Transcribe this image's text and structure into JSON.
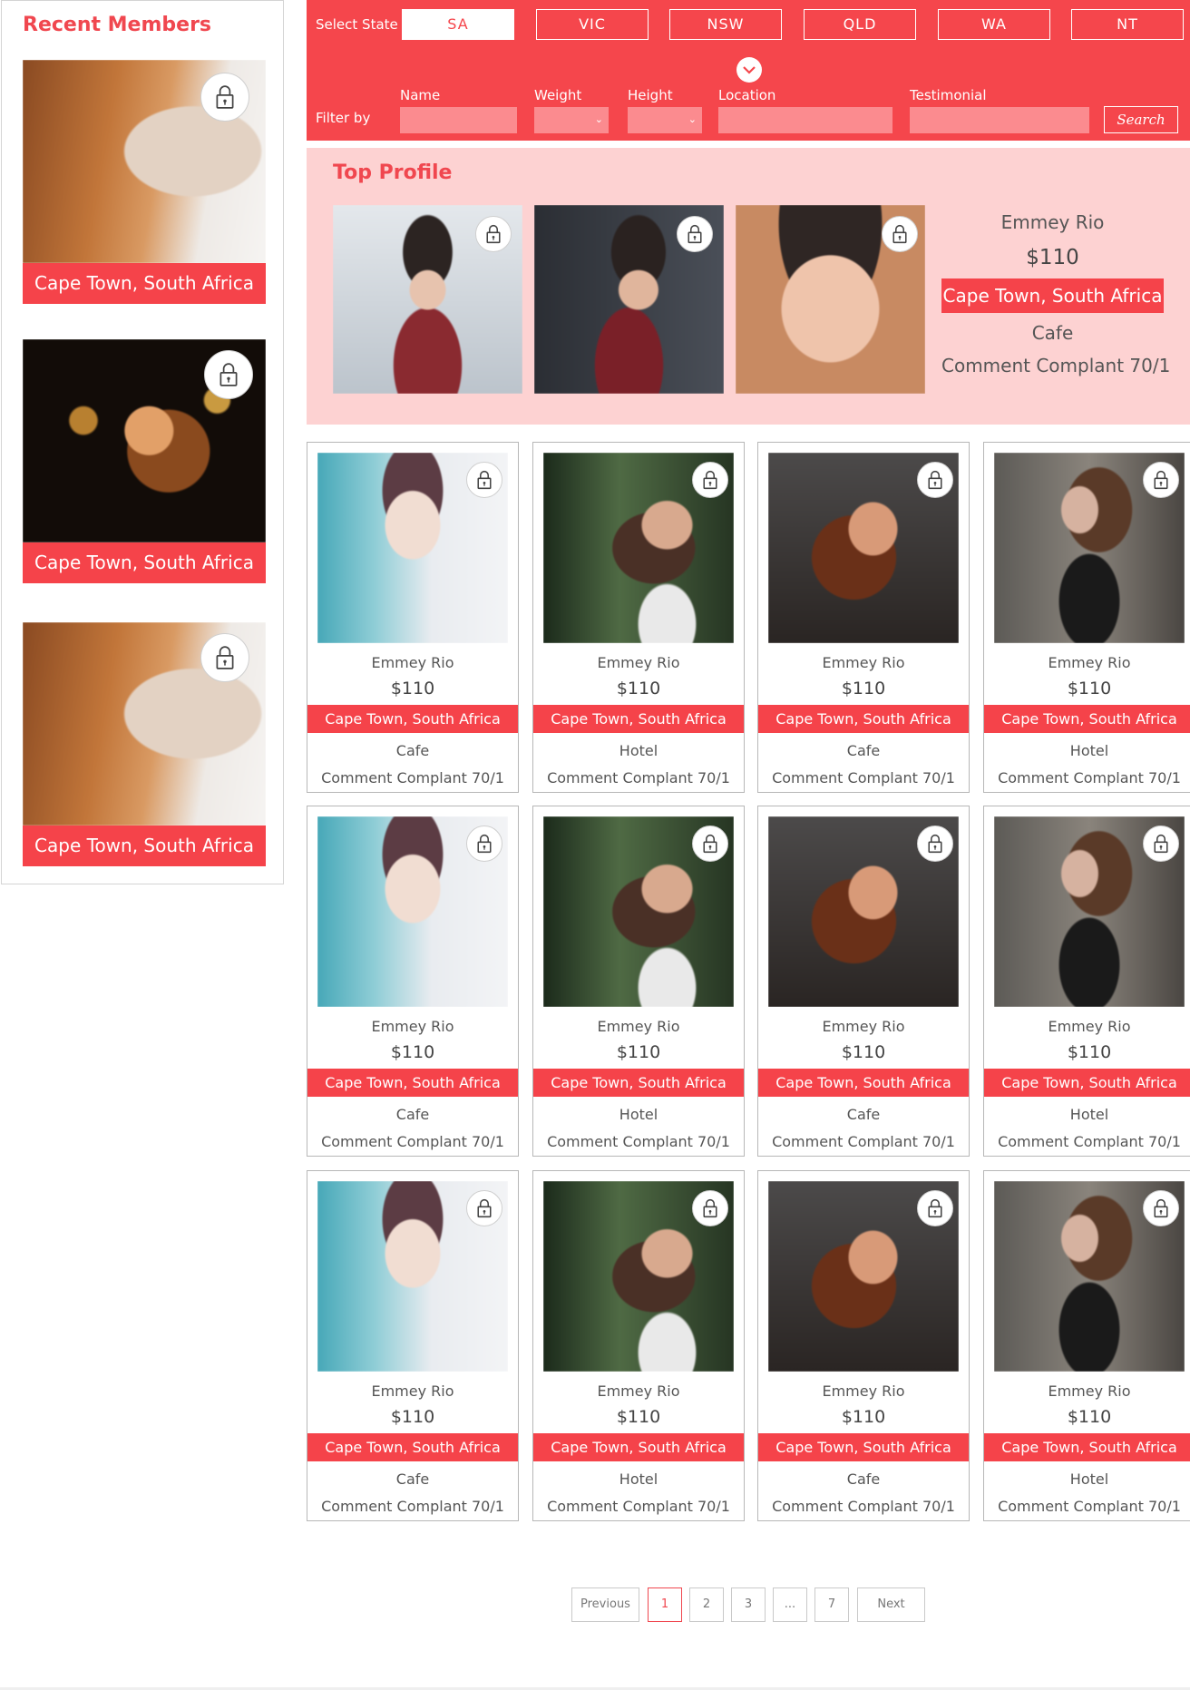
{
  "sidebar": {
    "title": "Recent Members",
    "members": [
      {
        "location": "Cape Town, South Africa",
        "photo": "ph-a"
      },
      {
        "location": "Cape Town, South Africa",
        "photo": "ph-b"
      },
      {
        "location": "Cape Town, South Africa",
        "photo": "ph-a"
      }
    ]
  },
  "filter": {
    "state_label": "Select State",
    "states": [
      {
        "label": "SA",
        "active": true
      },
      {
        "label": "VIC",
        "active": false
      },
      {
        "label": "NSW",
        "active": false
      },
      {
        "label": "QLD",
        "active": false
      },
      {
        "label": "WA",
        "active": false
      },
      {
        "label": "NT",
        "active": false
      }
    ],
    "filter_by_label": "Filter by",
    "fields": {
      "name_label": "Name",
      "weight_label": "Weight",
      "height_label": "Height",
      "location_label": "Location",
      "testimonial_label": "Testimonial"
    },
    "search_label": "Search",
    "colors": {
      "accent": "#f5464c",
      "input_fill": "#fb8b8f"
    }
  },
  "top_profile": {
    "title": "Top Profile",
    "name": "Emmey Rio",
    "price": "$110",
    "location": "Cape Town, South Africa",
    "venue": "Cafe",
    "comment": "Comment Complant  70/1",
    "photos": [
      "ph-g",
      "ph-h",
      "ph-i"
    ]
  },
  "grid": {
    "cards": [
      {
        "name": "Emmey Rio",
        "price": "$110",
        "location": "Cape Town, South Africa",
        "venue": "Cafe",
        "comment": "Comment Complant  70/1",
        "photo": "ph-c"
      },
      {
        "name": "Emmey Rio",
        "price": "$110",
        "location": "Cape Town, South Africa",
        "venue": "Hotel",
        "comment": "Comment Complant  70/1",
        "photo": "ph-d"
      },
      {
        "name": "Emmey Rio",
        "price": "$110",
        "location": "Cape Town, South Africa",
        "venue": "Cafe",
        "comment": "Comment Complant  70/1",
        "photo": "ph-e"
      },
      {
        "name": "Emmey Rio",
        "price": "$110",
        "location": "Cape Town, South Africa",
        "venue": "Hotel",
        "comment": "Comment Complant  70/1",
        "photo": "ph-f"
      },
      {
        "name": "Emmey Rio",
        "price": "$110",
        "location": "Cape Town, South Africa",
        "venue": "Cafe",
        "comment": "Comment Complant  70/1",
        "photo": "ph-c"
      },
      {
        "name": "Emmey Rio",
        "price": "$110",
        "location": "Cape Town, South Africa",
        "venue": "Hotel",
        "comment": "Comment Complant  70/1",
        "photo": "ph-d"
      },
      {
        "name": "Emmey Rio",
        "price": "$110",
        "location": "Cape Town, South Africa",
        "venue": "Cafe",
        "comment": "Comment Complant  70/1",
        "photo": "ph-e"
      },
      {
        "name": "Emmey Rio",
        "price": "$110",
        "location": "Cape Town, South Africa",
        "venue": "Hotel",
        "comment": "Comment Complant  70/1",
        "photo": "ph-f"
      },
      {
        "name": "Emmey Rio",
        "price": "$110",
        "location": "Cape Town, South Africa",
        "venue": "Cafe",
        "comment": "Comment Complant  70/1",
        "photo": "ph-c"
      },
      {
        "name": "Emmey Rio",
        "price": "$110",
        "location": "Cape Town, South Africa",
        "venue": "Hotel",
        "comment": "Comment Complant  70/1",
        "photo": "ph-d"
      },
      {
        "name": "Emmey Rio",
        "price": "$110",
        "location": "Cape Town, South Africa",
        "venue": "Cafe",
        "comment": "Comment Complant  70/1",
        "photo": "ph-e"
      },
      {
        "name": "Emmey Rio",
        "price": "$110",
        "location": "Cape Town, South Africa",
        "venue": "Hotel",
        "comment": "Comment Complant  70/1",
        "photo": "ph-f"
      }
    ]
  },
  "pagination": {
    "previous_label": "Previous",
    "pages": [
      {
        "label": "1",
        "active": true
      },
      {
        "label": "2",
        "active": false
      },
      {
        "label": "3",
        "active": false
      },
      {
        "label": "...",
        "active": false
      },
      {
        "label": "7",
        "active": false
      }
    ],
    "next_label": "Next"
  }
}
